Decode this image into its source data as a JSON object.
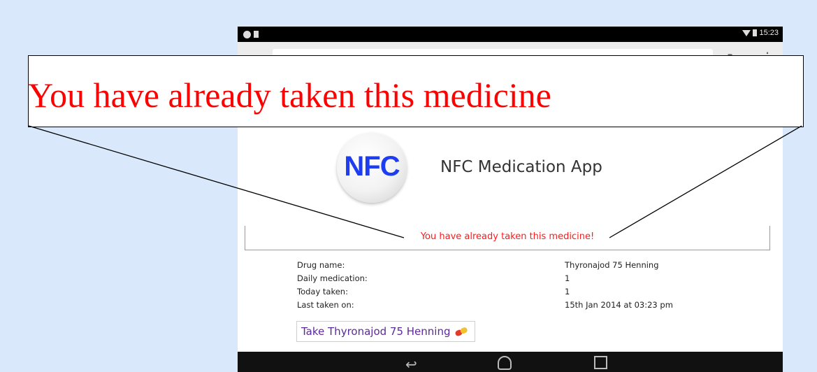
{
  "status_bar": {
    "time": "15:23"
  },
  "browser": {
    "url": ""
  },
  "app": {
    "logo_text": "NFC",
    "title": "NFC Medication App"
  },
  "message": "You have already taken this medicine!",
  "info": [
    {
      "label": "Drug name:",
      "value": "Thyronajod 75 Henning"
    },
    {
      "label": "Daily medication:",
      "value": "1"
    },
    {
      "label": "Today taken:",
      "value": "1"
    },
    {
      "label": "Last taken on:",
      "value": "15th Jan 2014 at 03:23 pm"
    }
  ],
  "take_button": {
    "label": "Take Thyronajod 75 Henning"
  },
  "callout": {
    "text": "You have already taken this medicine"
  },
  "colors": {
    "background": "#d9e8fb",
    "alert_red": "#ff0000",
    "logo_blue": "#1e3df0",
    "button_text": "#5b2a9b"
  },
  "icons": [
    "wifi-icon",
    "battery-icon",
    "back-chevron-icon",
    "reload-icon",
    "menu-icon",
    "pill-icon",
    "nav-back-icon",
    "nav-home-icon",
    "nav-recents-icon"
  ]
}
